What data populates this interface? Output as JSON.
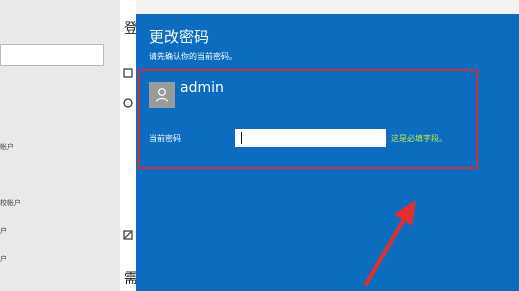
{
  "window": {
    "title_fragment": "登"
  },
  "sidebar": {
    "items": [
      {
        "label": "帐户"
      },
      {
        "label": "校帐户"
      },
      {
        "label": "户"
      },
      {
        "label": "户"
      }
    ]
  },
  "content": {
    "bottom_fragment": "需"
  },
  "dialog": {
    "title": "更改密码",
    "subtitle": "请先确认你的当前密码。",
    "account": {
      "name": "admin"
    },
    "password": {
      "label": "当前密码",
      "value": "",
      "placeholder": "",
      "required_hint": "这是必填字段。"
    }
  },
  "colors": {
    "dialog_background": "#0b6cc0",
    "highlight_border": "#c8323b",
    "hint_text": "#b9f04a",
    "arrow": "#e0302e"
  },
  "icons": {
    "avatar": "user-icon",
    "annotation": "red-arrow-icon"
  }
}
